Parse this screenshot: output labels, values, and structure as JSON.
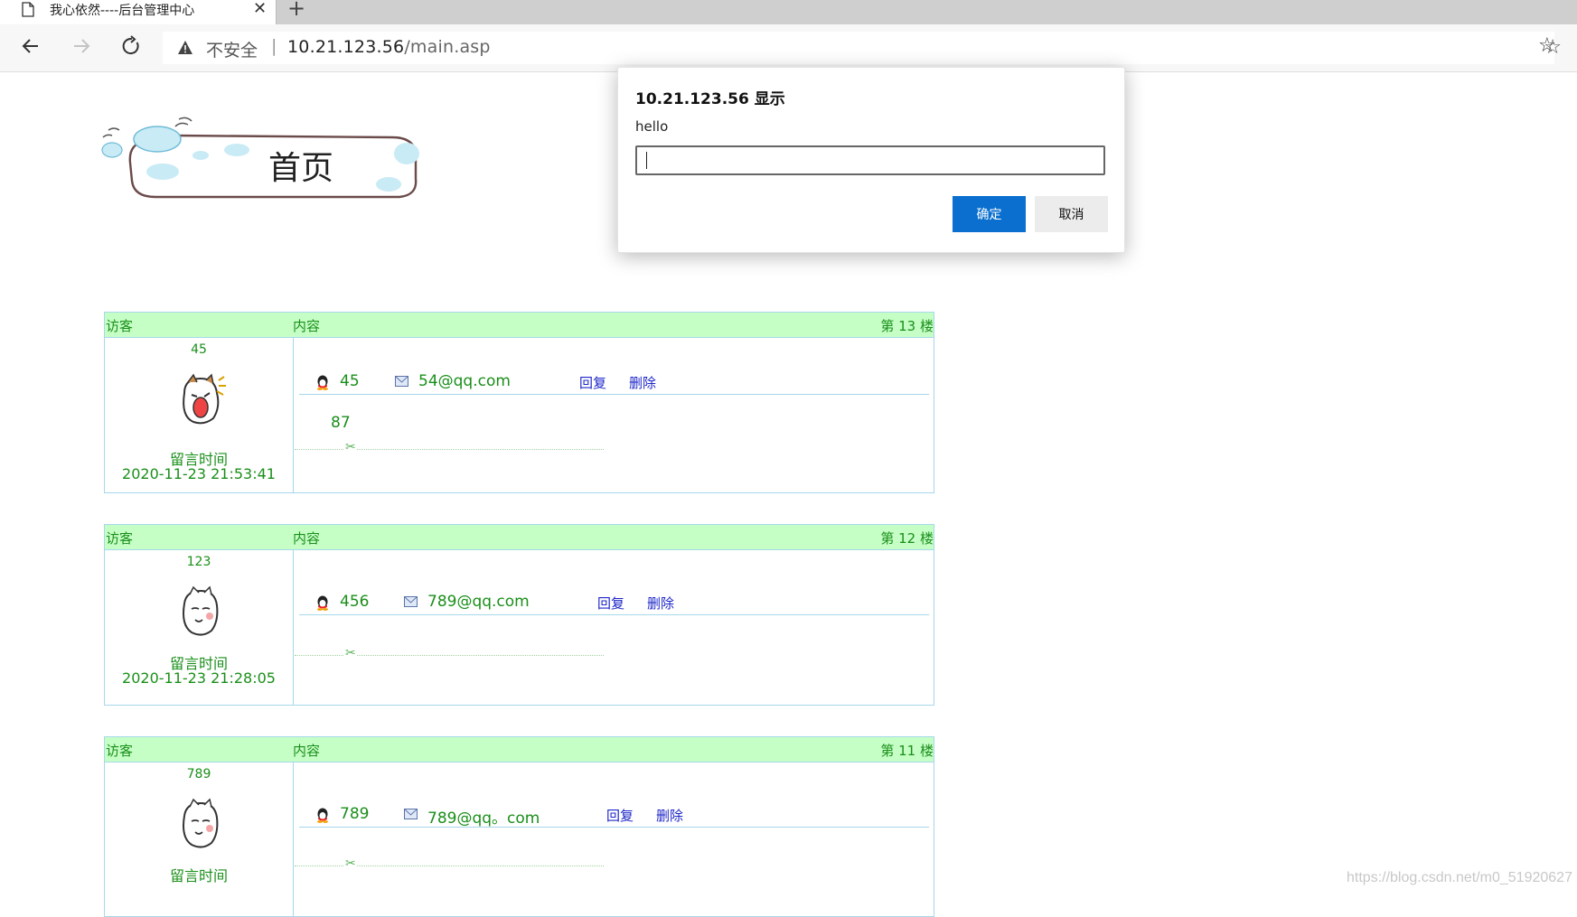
{
  "browser": {
    "tab_title": "我心依然----后台管理中心",
    "tab_close": "✕",
    "new_tab": "+",
    "insecure_label": "不安全",
    "url_separator": "|",
    "url_host": "10.21.123.56",
    "url_path": "/main.asp"
  },
  "banner": {
    "text": "首页"
  },
  "table_headers": {
    "visitor": "访客",
    "content": "内容"
  },
  "messages": [
    {
      "floor": "第 13 楼",
      "visitor_name": "45",
      "qq": "45",
      "email": "54@qq.com",
      "reply": "回复",
      "delete": "删除",
      "body": "87",
      "time_label": "留言时间",
      "time": "2020-11-23 21:53:41"
    },
    {
      "floor": "第 12 楼",
      "visitor_name": "123",
      "qq": "456",
      "email": "789@qq.com",
      "reply": "回复",
      "delete": "删除",
      "body": "",
      "time_label": "留言时间",
      "time": "2020-11-23 21:28:05"
    },
    {
      "floor": "第 11 楼",
      "visitor_name": "789",
      "qq": "789",
      "email": "789@qq。com",
      "reply": "回复",
      "delete": "删除",
      "body": "",
      "time_label": "留言时间",
      "time": ""
    }
  ],
  "dialog": {
    "title": "10.21.123.56 显示",
    "message": "hello",
    "input_value": "",
    "ok_label": "确定",
    "cancel_label": "取消"
  },
  "watermark": "https://blog.csdn.net/m0_51920627",
  "colors": {
    "header_bg": "#c6ffc6",
    "green_text": "#1a8f1a",
    "link_blue": "#1d26c8",
    "border_blue": "#a6d8ea",
    "ok_button": "#0a6fcf"
  }
}
